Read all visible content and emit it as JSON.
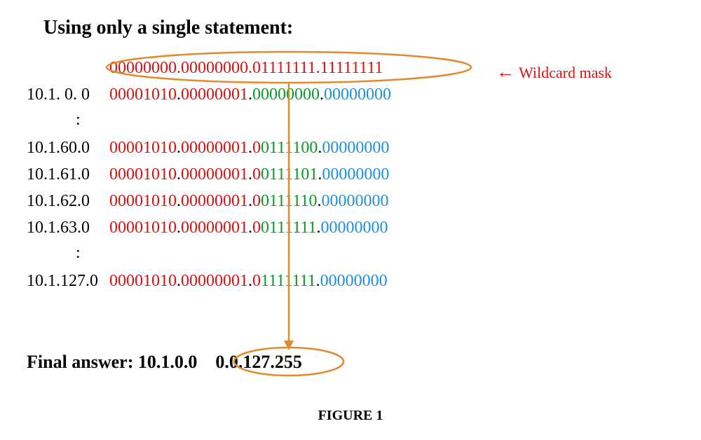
{
  "title": "Using only a single statement:",
  "wildcard_mask": {
    "binary": "00000000.00000000.01111111.11111111",
    "label": "Wildcard mask"
  },
  "rows": [
    {
      "ip": "10.1. 0. 0",
      "oct1": "00001010",
      "oct2": "00000001",
      "oct3_head": "0",
      "oct3_tail": "0000000",
      "oct4": "00000000"
    },
    {
      "ip": "10.1.60.0",
      "oct1": "00001010",
      "oct2": "00000001",
      "oct3_head": "0",
      "oct3_tail": "0111100",
      "oct4": "00000000"
    },
    {
      "ip": "10.1.61.0",
      "oct1": "00001010",
      "oct2": "00000001",
      "oct3_head": "0",
      "oct3_tail": "0111101",
      "oct4": "00000000"
    },
    {
      "ip": "10.1.62.0",
      "oct1": "00001010",
      "oct2": "00000001",
      "oct3_head": "0",
      "oct3_tail": "0111110",
      "oct4": "00000000"
    },
    {
      "ip": "10.1.63.0",
      "oct1": "00001010",
      "oct2": "00000001",
      "oct3_head": "0",
      "oct3_tail": "0111111",
      "oct4": "00000000"
    },
    {
      "ip": "10.1.127.0",
      "oct1": "00001010",
      "oct2": "00000001",
      "oct3_head": "0",
      "oct3_tail": "1111111",
      "oct4": "00000000"
    }
  ],
  "final": {
    "label": "Final answer:  ",
    "network": "10.1.0.0",
    "mask": "0.0.127.255"
  },
  "figure_label": "FIGURE 1",
  "colors": {
    "red": "#d11",
    "green": "#0a9a26",
    "blue": "#1e90d8",
    "orange": "#e08a2c"
  }
}
